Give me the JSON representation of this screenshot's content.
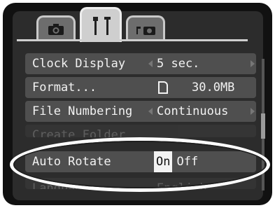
{
  "tabs": [
    {
      "name": "shooting",
      "icon": "camera-icon"
    },
    {
      "name": "setup",
      "icon": "tools-icon",
      "active": true
    },
    {
      "name": "my-menu",
      "icon": "my-camera-icon"
    }
  ],
  "menu": {
    "rows": [
      {
        "label": "Clock Display",
        "value": "5 sec."
      },
      {
        "label": "Format...",
        "value": "30.0MB",
        "value_icon": "file-icon"
      },
      {
        "label": "File Numbering",
        "value": "Continuous"
      },
      {
        "label": "Create Folder",
        "value": ""
      },
      {
        "label": "Auto Rotate",
        "value_on": "On",
        "value_off": "Off",
        "selected": "On"
      },
      {
        "label": "Language",
        "value": "English"
      }
    ]
  },
  "colors": {
    "background": "#2c2c2c",
    "row": "#4f4f4f",
    "text": "#f2f2f2",
    "tab_active": "#cfcfcf",
    "highlight_oval": "#ffffff"
  }
}
